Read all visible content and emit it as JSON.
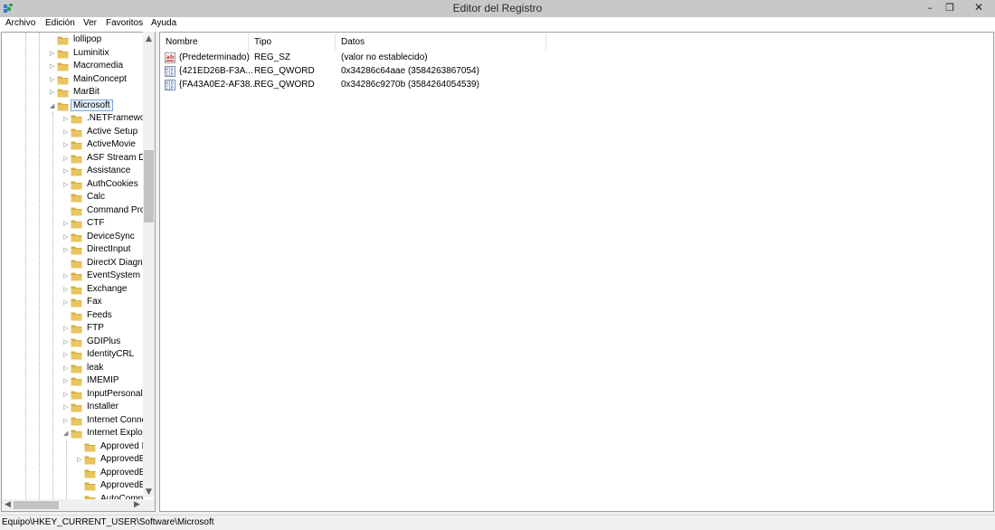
{
  "window": {
    "title": "Editor del Registro",
    "icon": "regedit-icon",
    "controls": {
      "minimize": "–",
      "maximize": "❐",
      "close": "✕"
    }
  },
  "menu": {
    "items": [
      "Archivo",
      "Edición",
      "Ver",
      "Favoritos",
      "Ayuda"
    ]
  },
  "tree": {
    "selected": "Microsoft",
    "nodes": [
      {
        "label": "lollipop",
        "level": 1,
        "expander": ""
      },
      {
        "label": "Luminitix",
        "level": 1,
        "expander": "▷"
      },
      {
        "label": "Macromedia",
        "level": 1,
        "expander": "▷"
      },
      {
        "label": "MainConcept",
        "level": 1,
        "expander": "▷"
      },
      {
        "label": "MarBit",
        "level": 1,
        "expander": "▷"
      },
      {
        "label": "Microsoft",
        "level": 1,
        "expander": "◢",
        "selected": true
      },
      {
        "label": ".NETFramewor",
        "level": 2,
        "expander": "▷"
      },
      {
        "label": "Active Setup",
        "level": 2,
        "expander": "▷"
      },
      {
        "label": "ActiveMovie",
        "level": 2,
        "expander": "▷"
      },
      {
        "label": "ASF Stream De",
        "level": 2,
        "expander": "▷"
      },
      {
        "label": "Assistance",
        "level": 2,
        "expander": "▷"
      },
      {
        "label": "AuthCookies",
        "level": 2,
        "expander": "▷"
      },
      {
        "label": "Calc",
        "level": 2,
        "expander": ""
      },
      {
        "label": "Command Pro",
        "level": 2,
        "expander": ""
      },
      {
        "label": "CTF",
        "level": 2,
        "expander": "▷"
      },
      {
        "label": "DeviceSync",
        "level": 2,
        "expander": "▷"
      },
      {
        "label": "DirectInput",
        "level": 2,
        "expander": "▷"
      },
      {
        "label": "DirectX Diagno",
        "level": 2,
        "expander": ""
      },
      {
        "label": "EventSystem",
        "level": 2,
        "expander": "▷"
      },
      {
        "label": "Exchange",
        "level": 2,
        "expander": "▷"
      },
      {
        "label": "Fax",
        "level": 2,
        "expander": "▷"
      },
      {
        "label": "Feeds",
        "level": 2,
        "expander": ""
      },
      {
        "label": "FTP",
        "level": 2,
        "expander": "▷"
      },
      {
        "label": "GDIPlus",
        "level": 2,
        "expander": "▷"
      },
      {
        "label": "IdentityCRL",
        "level": 2,
        "expander": "▷"
      },
      {
        "label": "leak",
        "level": 2,
        "expander": "▷"
      },
      {
        "label": "IMEMIP",
        "level": 2,
        "expander": "▷"
      },
      {
        "label": "InputPersonali",
        "level": 2,
        "expander": "▷"
      },
      {
        "label": "Installer",
        "level": 2,
        "expander": "▷"
      },
      {
        "label": "Internet Conne",
        "level": 2,
        "expander": "▷"
      },
      {
        "label": "Internet Explor",
        "level": 2,
        "expander": "◢"
      },
      {
        "label": "Approved E",
        "level": 3,
        "expander": ""
      },
      {
        "label": "ApprovedE",
        "level": 3,
        "expander": "▷"
      },
      {
        "label": "ApprovedE",
        "level": 3,
        "expander": ""
      },
      {
        "label": "ApprovedE",
        "level": 3,
        "expander": ""
      },
      {
        "label": "AutoComp",
        "level": 3,
        "expander": ""
      }
    ]
  },
  "tree_scroll": {
    "up": "▲",
    "down": "▼",
    "left": "◀",
    "right": "▶"
  },
  "values": {
    "columns": [
      "Nombre",
      "Tipo",
      "Datos"
    ],
    "rows": [
      {
        "icon": "string-value-icon",
        "name": "(Predeterminado)",
        "type": "REG_SZ",
        "data": "(valor no establecido)"
      },
      {
        "icon": "binary-value-icon",
        "name": "{421ED26B-F3A...",
        "type": "REG_QWORD",
        "data": "0x34286c64aae (3584263867054)"
      },
      {
        "icon": "binary-value-icon",
        "name": "{FA43A0E2-AF38...",
        "type": "REG_QWORD",
        "data": "0x34286c9270b (3584264054539)"
      }
    ]
  },
  "status": {
    "path": "Equipo\\HKEY_CURRENT_USER\\Software\\Microsoft"
  },
  "colors": {
    "titlebar": "#c8c8c8",
    "folder": "#e8c561",
    "selection_border": "#7ea7d8"
  }
}
